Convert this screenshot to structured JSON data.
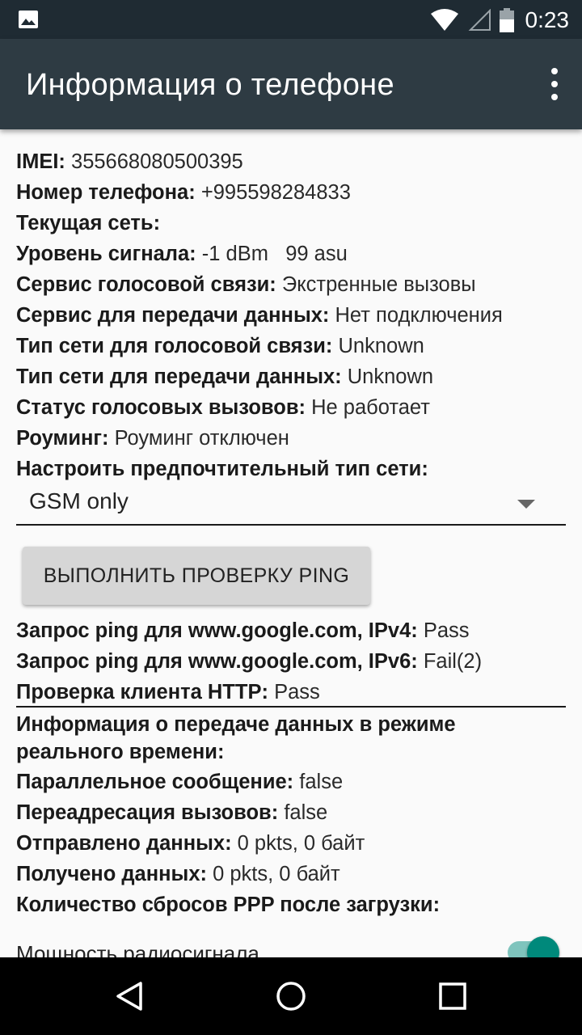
{
  "status_bar": {
    "time": "0:23",
    "icons": [
      "image-notification-icon",
      "wifi-icon",
      "cell-signal-icon",
      "battery-icon"
    ]
  },
  "app_bar": {
    "title": "Информация о телефоне",
    "overflow_icon": "more-vert-icon"
  },
  "info": [
    {
      "label": "IMEI:",
      "value": "355668080500395"
    },
    {
      "label": "Номер телефона:",
      "value": "+995598284833"
    },
    {
      "label": "Текущая сеть:",
      "value": ""
    },
    {
      "label": "Уровень сигнала:",
      "value": "-1 dBm   99 asu"
    },
    {
      "label": "Сервис голосовой связи:",
      "value": "Экстренные вызовы"
    },
    {
      "label": "Сервис для передачи данных:",
      "value": "Нет подключения"
    },
    {
      "label": "Тип сети для голосовой связи:",
      "value": "Unknown"
    },
    {
      "label": "Тип сети для передачи данных:",
      "value": "Unknown"
    },
    {
      "label": "Статус голосовых вызовов:",
      "value": "Не работает"
    },
    {
      "label": "Роуминг:",
      "value": "Роуминг отключен"
    },
    {
      "label": "Настроить предпочтительный тип сети:",
      "value": ""
    }
  ],
  "network_type": {
    "selected": "GSM only"
  },
  "ping_button": {
    "label": "ВЫПОЛНИТЬ ПРОВЕРКУ PING"
  },
  "ping_results": [
    {
      "label": "Запрос ping для www.google.com, IPv4:",
      "value": "Pass"
    },
    {
      "label": "Запрос ping для www.google.com, IPv6:",
      "value": "Fail(2)"
    },
    {
      "label": "Проверка клиента HTTP:",
      "value": "Pass"
    }
  ],
  "realtime": {
    "heading_line1": "Информация о передаче данных в режиме",
    "heading_line2": "реального времени:"
  },
  "data_info": [
    {
      "label": "Параллельное сообщение:",
      "value": "false"
    },
    {
      "label": "Переадресация вызовов:",
      "value": "false"
    },
    {
      "label": "Отправлено данных:",
      "value": "0 pkts, 0 байт"
    },
    {
      "label": "Получено данных:",
      "value": "0 pkts, 0 байт"
    },
    {
      "label": "Количество сбросов PPP после загрузки:",
      "value": ""
    }
  ],
  "radio_power": {
    "label": "Мощность радиосигнала",
    "enabled": true
  },
  "nav_bar": {
    "icons": [
      "back-icon",
      "home-icon",
      "recents-icon"
    ]
  }
}
